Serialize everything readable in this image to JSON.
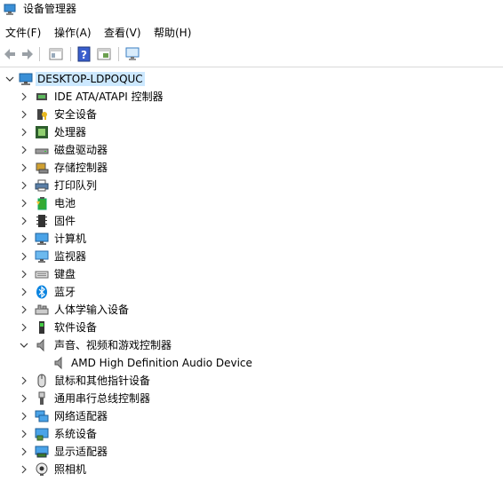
{
  "window": {
    "title": "设备管理器"
  },
  "menu": {
    "items": [
      {
        "label": "文件(F)"
      },
      {
        "label": "操作(A)"
      },
      {
        "label": "查看(V)"
      },
      {
        "label": "帮助(H)"
      }
    ]
  },
  "toolbar": {
    "buttons": [
      {
        "icon": "back-arrow-icon"
      },
      {
        "icon": "forward-arrow-icon"
      },
      {
        "icon": "properties-pane-icon"
      },
      {
        "icon": "help-icon"
      },
      {
        "icon": "device-view-icon"
      },
      {
        "icon": "monitor-scan-icon"
      }
    ]
  },
  "tree": {
    "root": {
      "label": "DESKTOP-LDPOQUC",
      "icon": "computer-icon",
      "expanded": true
    },
    "categories": [
      {
        "label": "IDE ATA/ATAPI 控制器",
        "icon": "ide-controller-icon"
      },
      {
        "label": "安全设备",
        "icon": "security-device-icon"
      },
      {
        "label": "处理器",
        "icon": "processor-icon"
      },
      {
        "label": "磁盘驱动器",
        "icon": "disk-drive-icon"
      },
      {
        "label": "存储控制器",
        "icon": "storage-controller-icon"
      },
      {
        "label": "打印队列",
        "icon": "printer-icon"
      },
      {
        "label": "电池",
        "icon": "battery-icon"
      },
      {
        "label": "固件",
        "icon": "firmware-icon"
      },
      {
        "label": "计算机",
        "icon": "computer-monitor-icon"
      },
      {
        "label": "监视器",
        "icon": "monitor-icon"
      },
      {
        "label": "键盘",
        "icon": "keyboard-icon"
      },
      {
        "label": "蓝牙",
        "icon": "bluetooth-icon"
      },
      {
        "label": "人体学输入设备",
        "icon": "hid-icon"
      },
      {
        "label": "软件设备",
        "icon": "software-device-icon"
      },
      {
        "label": "声音、视频和游戏控制器",
        "icon": "speaker-icon",
        "expanded": true,
        "children": [
          {
            "label": "AMD High Definition Audio Device",
            "icon": "speaker-icon"
          }
        ]
      },
      {
        "label": "鼠标和其他指针设备",
        "icon": "mouse-icon"
      },
      {
        "label": "通用串行总线控制器",
        "icon": "usb-icon"
      },
      {
        "label": "网络适配器",
        "icon": "network-adapter-icon"
      },
      {
        "label": "系统设备",
        "icon": "system-device-icon"
      },
      {
        "label": "显示适配器",
        "icon": "display-adapter-icon"
      },
      {
        "label": "照相机",
        "icon": "camera-icon"
      }
    ]
  },
  "colors": {
    "selection": "#cce8ff",
    "accent": "#0078d7"
  }
}
